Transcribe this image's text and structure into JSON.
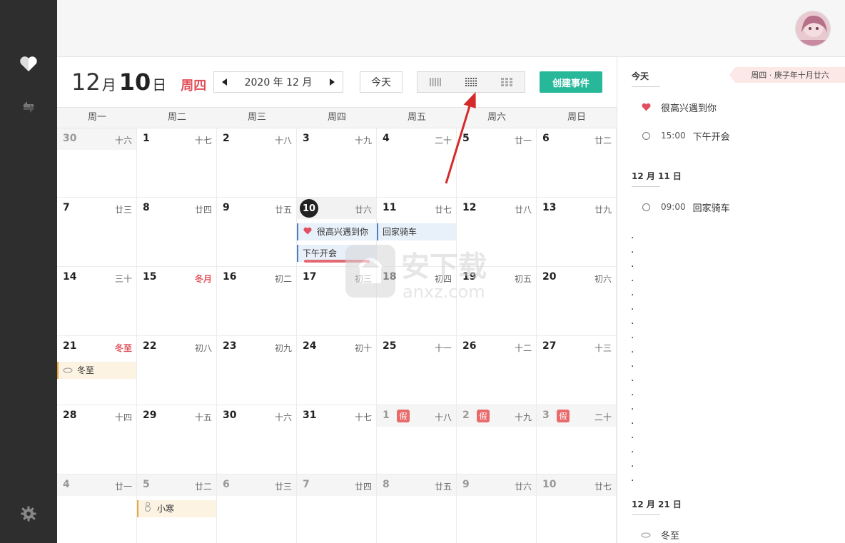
{
  "topbar": {
    "avatar": "avatar"
  },
  "rail": {
    "items": [
      "heart-icon",
      "sync-icon",
      "gear-icon"
    ]
  },
  "header": {
    "month_num": "12",
    "month_unit": "月",
    "day_num": "10",
    "day_unit": "日",
    "weekday": "周四",
    "month_label": "2020 年 12 月",
    "prev": "◀",
    "next": "▶",
    "today_label": "今天",
    "create_label": "创建事件"
  },
  "weekdays": [
    "周一",
    "周二",
    "周三",
    "周四",
    "周五",
    "周六",
    "周日"
  ],
  "weeks": [
    [
      {
        "d": "30",
        "l": "十六",
        "o": true
      },
      {
        "d": "1",
        "l": "十七"
      },
      {
        "d": "2",
        "l": "十八"
      },
      {
        "d": "3",
        "l": "十九"
      },
      {
        "d": "4",
        "l": "二十"
      },
      {
        "d": "5",
        "l": "廿一"
      },
      {
        "d": "6",
        "l": "廿二"
      }
    ],
    [
      {
        "d": "7",
        "l": "廿三"
      },
      {
        "d": "8",
        "l": "廿四"
      },
      {
        "d": "9",
        "l": "廿五"
      },
      {
        "d": "10",
        "l": "廿六",
        "t": true
      },
      {
        "d": "11",
        "l": "廿七"
      },
      {
        "d": "12",
        "l": "廿八"
      },
      {
        "d": "13",
        "l": "廿九"
      }
    ],
    [
      {
        "d": "14",
        "l": "三十"
      },
      {
        "d": "15",
        "l": "冬月",
        "r": true
      },
      {
        "d": "16",
        "l": "初二"
      },
      {
        "d": "17",
        "l": "初三"
      },
      {
        "d": "18",
        "l": "初四"
      },
      {
        "d": "19",
        "l": "初五"
      },
      {
        "d": "20",
        "l": "初六"
      }
    ],
    [
      {
        "d": "21",
        "l": "冬至",
        "r": true
      },
      {
        "d": "22",
        "l": "初八"
      },
      {
        "d": "23",
        "l": "初九"
      },
      {
        "d": "24",
        "l": "初十"
      },
      {
        "d": "25",
        "l": "十一"
      },
      {
        "d": "26",
        "l": "十二"
      },
      {
        "d": "27",
        "l": "十三"
      }
    ],
    [
      {
        "d": "28",
        "l": "十四"
      },
      {
        "d": "29",
        "l": "十五"
      },
      {
        "d": "30",
        "l": "十六"
      },
      {
        "d": "31",
        "l": "十七"
      },
      {
        "d": "1",
        "l": "十八",
        "o": true,
        "h": "假"
      },
      {
        "d": "2",
        "l": "十九",
        "o": true,
        "h": "假"
      },
      {
        "d": "3",
        "l": "二十",
        "o": true,
        "h": "假"
      }
    ],
    [
      {
        "d": "4",
        "l": "廿一",
        "o": true
      },
      {
        "d": "5",
        "l": "廿二",
        "o": true
      },
      {
        "d": "6",
        "l": "廿三",
        "o": true
      },
      {
        "d": "7",
        "l": "廿四",
        "o": true
      },
      {
        "d": "8",
        "l": "廿五",
        "o": true
      },
      {
        "d": "9",
        "l": "廿六",
        "o": true
      },
      {
        "d": "10",
        "l": "廿七",
        "o": true
      }
    ]
  ],
  "events": {
    "ev1": "很高兴遇到你",
    "ev2": "回家骑车",
    "ev3": "下午开会",
    "ev4": "冬至",
    "ev5": "小寒"
  },
  "panel": {
    "lunar_tag": "周四 · 庚子年十月廿六",
    "today_title": "今天",
    "today_items": [
      {
        "time": "",
        "title": "很高兴遇到你",
        "icon": "heart-icon"
      },
      {
        "time": "15:00",
        "title": "下午开会",
        "icon": "circle-icon"
      }
    ],
    "dec11_title": "12 月 11 日",
    "dec11_items": [
      {
        "time": "09:00",
        "title": "回家骑车",
        "icon": "circle-icon"
      }
    ],
    "dec21_title": "12 月 21 日",
    "dec21_items": [
      {
        "title": "冬至",
        "icon": "cloud-icon"
      }
    ]
  },
  "watermark": {
    "cn": "安下载",
    "en": "anxz.com"
  },
  "colors": {
    "accent": "#27b89a",
    "red": "#e0505a",
    "rail": "#2e2e2e",
    "event_blue": "#4a7fc6",
    "event_cream": "#e0a840"
  }
}
